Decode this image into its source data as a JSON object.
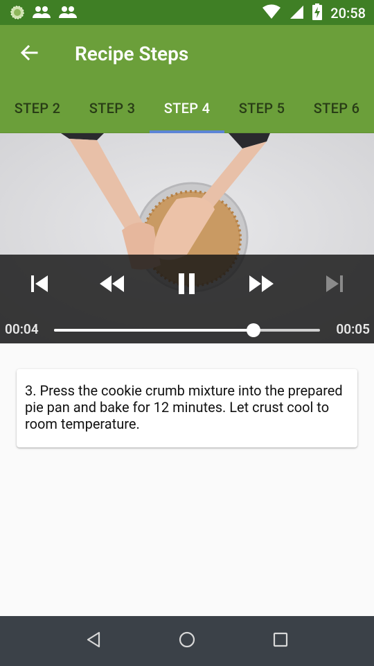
{
  "status_bar": {
    "time": "20:58",
    "icons": [
      "app-notification-icon",
      "group-icon",
      "group-icon",
      "wifi-icon",
      "signal-icon",
      "battery-charging-icon"
    ]
  },
  "app_bar": {
    "title": "Recipe Steps",
    "back_icon": "arrow-back-icon"
  },
  "tabs": [
    {
      "label": "STEP 2",
      "active": false
    },
    {
      "label": "STEP 3",
      "active": false
    },
    {
      "label": "STEP 4",
      "active": true
    },
    {
      "label": "STEP 5",
      "active": false
    },
    {
      "label": "STEP 6",
      "active": false
    }
  ],
  "player": {
    "position": "00:04",
    "duration": "00:05",
    "progress_fraction": 0.75,
    "controls": [
      "skip-previous-icon",
      "rewind-icon",
      "pause-icon",
      "fast-forward-icon",
      "skip-next-icon"
    ]
  },
  "step": {
    "description": "3. Press the cookie crumb mixture into the prepared pie pan and bake for 12 minutes. Let crust cool to room temperature."
  },
  "colors": {
    "status_bar": "#3f7f25",
    "primary": "#6b9f3a",
    "tab_indicator": "#5c84d6",
    "nav_bar": "#3b4148"
  }
}
